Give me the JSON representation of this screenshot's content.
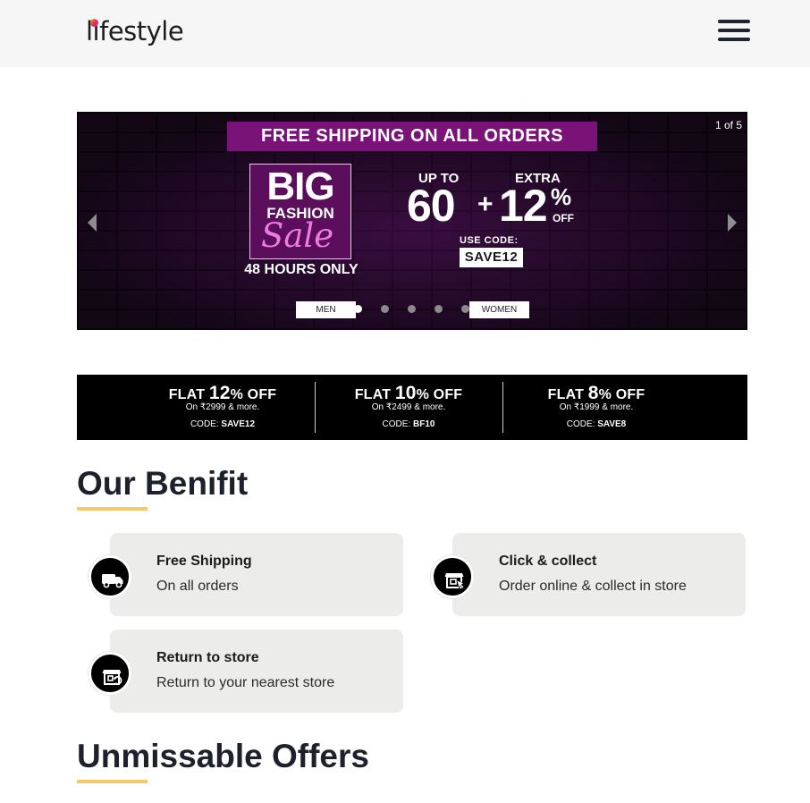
{
  "header": {
    "logo_text": "lifestyle",
    "menu_icon": "hamburger-menu-icon"
  },
  "banner": {
    "shipping_text": "FREE SHIPPING ON ALL ORDERS",
    "counter": "1 of 5",
    "sale_big": "BIG",
    "sale_fashion": "FASHION",
    "sale_script": "Sale",
    "hours": "48 HOURS ONLY",
    "up_to": "UP TO",
    "extra": "EXTRA",
    "discount_one": "60",
    "plus": "+",
    "discount_two": "12",
    "percent": "%",
    "off": "OFF",
    "use_code_label": "USE CODE:",
    "code": "SAVE12",
    "men_label": "MEN",
    "women_label": "WOMEN",
    "slide_count": 5,
    "active_slide": 1,
    "accent_color": "#7a1377"
  },
  "flat_offers": [
    {
      "prefix": "FLAT ",
      "num": "12",
      "suffix": "% OFF",
      "sub": "On ₹2999 & more.",
      "code_label": "CODE: ",
      "code": "SAVE12"
    },
    {
      "prefix": "FLAT ",
      "num": "10",
      "suffix": "% OFF",
      "sub": "On ₹2499 & more.",
      "code_label": "CODE: ",
      "code": "BF10"
    },
    {
      "prefix": "FLAT ",
      "num": "8",
      "suffix": "% OFF",
      "sub": "On ₹1999 & more.",
      "code_label": "CODE: ",
      "code": "SAVE8"
    }
  ],
  "benefits": {
    "title": "Our Benifit",
    "underline_color": "#f4c96c",
    "items": [
      {
        "title": "Free Shipping",
        "subtitle": "On all orders",
        "icon": "delivery-truck-icon"
      },
      {
        "title": "Click & collect",
        "subtitle": "Order online & collect in store",
        "icon": "store-click-icon"
      },
      {
        "title": "Return to store",
        "subtitle": "Return to your nearest store",
        "icon": "store-return-icon"
      }
    ]
  },
  "offers": {
    "title": "Unmissable Offers"
  }
}
